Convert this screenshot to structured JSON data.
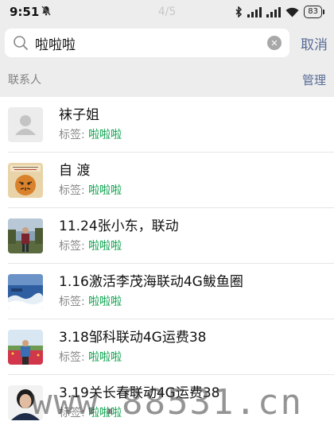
{
  "status_bar": {
    "time": "9:51",
    "page_indicator": "4/5",
    "battery": "83"
  },
  "search": {
    "query": "啦啦啦",
    "cancel_label": "取消"
  },
  "section": {
    "title": "联系人",
    "manage_label": "管理"
  },
  "contacts": [
    {
      "name": "袜子姐",
      "tag_label": "标签: ",
      "tag": "啦啦啦",
      "avatar": "default-avatar"
    },
    {
      "name": "自 渡",
      "tag_label": "标签: ",
      "tag": "啦啦啦",
      "avatar": "tiger-picture"
    },
    {
      "name": "11.24张小东，联动",
      "tag_label": "标签: ",
      "tag": "啦啦啦",
      "avatar": "person-outdoor-photo"
    },
    {
      "name": "1.16激活李茂海联动4G鲅鱼圈",
      "tag_label": "标签: ",
      "tag": "啦啦啦",
      "avatar": "sea-photo"
    },
    {
      "name": "3.18邹科联动4G运费38",
      "tag_label": "标签: ",
      "tag": "啦啦啦",
      "avatar": "flower-field-photo"
    },
    {
      "name": "3.19关长春联动4G运费38",
      "tag_label": "标签: ",
      "tag": "啦啦啦",
      "avatar": "portrait-photo"
    }
  ],
  "watermark": "www.88531.cn",
  "colors": {
    "link": "#576b95",
    "tag": "#07a04a",
    "background": "#ededed"
  }
}
